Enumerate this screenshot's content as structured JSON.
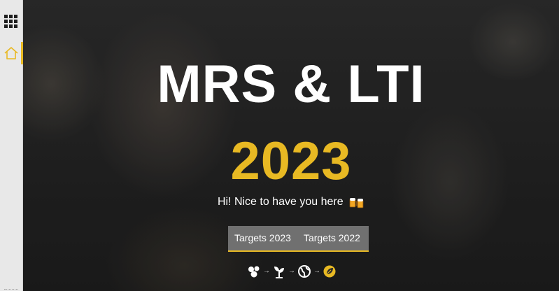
{
  "sidebar": {
    "apps_icon": "waffle-icon",
    "items": [
      {
        "icon": "home-icon",
        "active": true
      }
    ]
  },
  "hero": {
    "title": "MRS & LTI",
    "year": "2023",
    "subtitle": "Hi! Nice to have you here",
    "subtitle_emoji": "beer-mugs-icon"
  },
  "tabs": [
    {
      "label": "Targets 2023"
    },
    {
      "label": "Targets 2022"
    }
  ],
  "flow": {
    "steps": [
      "molecules-icon",
      "sprout-icon",
      "globe-icon",
      "leaf-coin-icon"
    ],
    "arrow": "→"
  },
  "colors": {
    "accent": "#e8b923",
    "title": "#ffffff",
    "tab_background": "#707070",
    "sidebar": "#e8e8e8"
  }
}
